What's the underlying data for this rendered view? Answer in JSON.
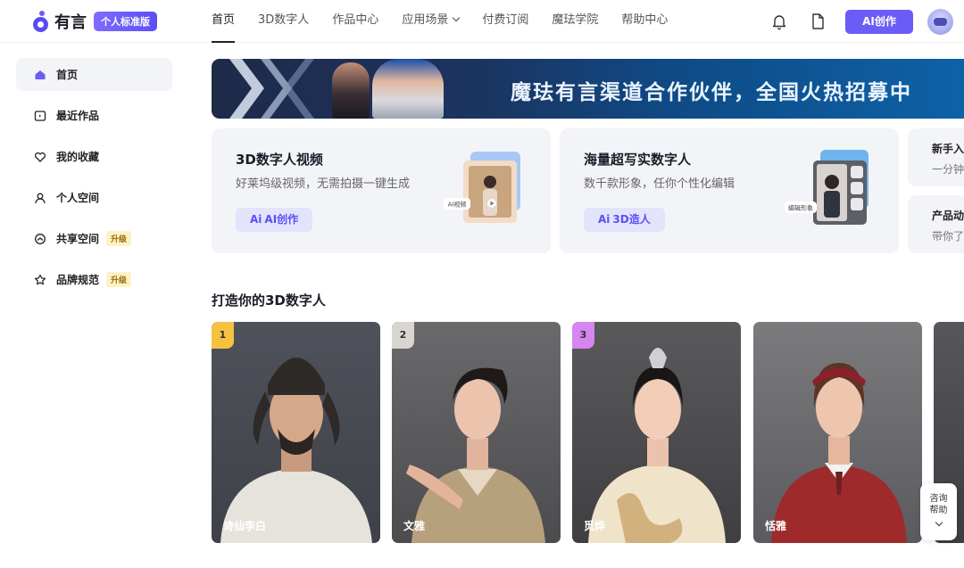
{
  "brand": {
    "logo_text": "有言",
    "plan": "个人标准版"
  },
  "nav": {
    "items": [
      "首页",
      "3D数字人",
      "作品中心",
      "应用场景",
      "付费订阅",
      "魔珐学院",
      "帮助中心"
    ]
  },
  "header": {
    "ai_button": "AI创作"
  },
  "sidebar": {
    "items": [
      {
        "label": "首页",
        "icon": "home-icon"
      },
      {
        "label": "最近作品",
        "icon": "recent-icon"
      },
      {
        "label": "我的收藏",
        "icon": "heart-icon"
      },
      {
        "label": "个人空间",
        "icon": "user-icon"
      },
      {
        "label": "共享空间",
        "icon": "share-icon",
        "badge": "升级"
      },
      {
        "label": "品牌规范",
        "icon": "brand-icon",
        "badge": "升级"
      }
    ]
  },
  "banner": {
    "text": "魔珐有言渠道合作伙伴，全国火热招募中"
  },
  "cards": [
    {
      "title": "3D数字人视频",
      "subtitle": "好莱坞级视频，无需拍摄一键生成",
      "button": "AI创作",
      "tag": "AI视频"
    },
    {
      "title": "海量超写实数字人",
      "subtitle": "数千款形象，任你个性化编辑",
      "button": "3D造人",
      "tag": "编辑形象"
    }
  ],
  "side_cards": [
    {
      "title": "新手入",
      "subtitle": "一分钟"
    },
    {
      "title": "产品动",
      "subtitle": "带你了"
    }
  ],
  "section": {
    "title": "打造你的3D数字人"
  },
  "digital_humans": [
    {
      "name": "诗仙李白",
      "rank": "1"
    },
    {
      "name": "文雅",
      "rank": "2"
    },
    {
      "name": "觅烨",
      "rank": "3"
    },
    {
      "name": "恬雅",
      "rank": ""
    }
  ],
  "help": {
    "label_1": "咨询",
    "label_2": "帮助"
  },
  "colors": {
    "accent": "#6a5cf6",
    "rank1": "#f4c240",
    "rank2": "#d9d6cf",
    "rank3": "#d785f0"
  }
}
